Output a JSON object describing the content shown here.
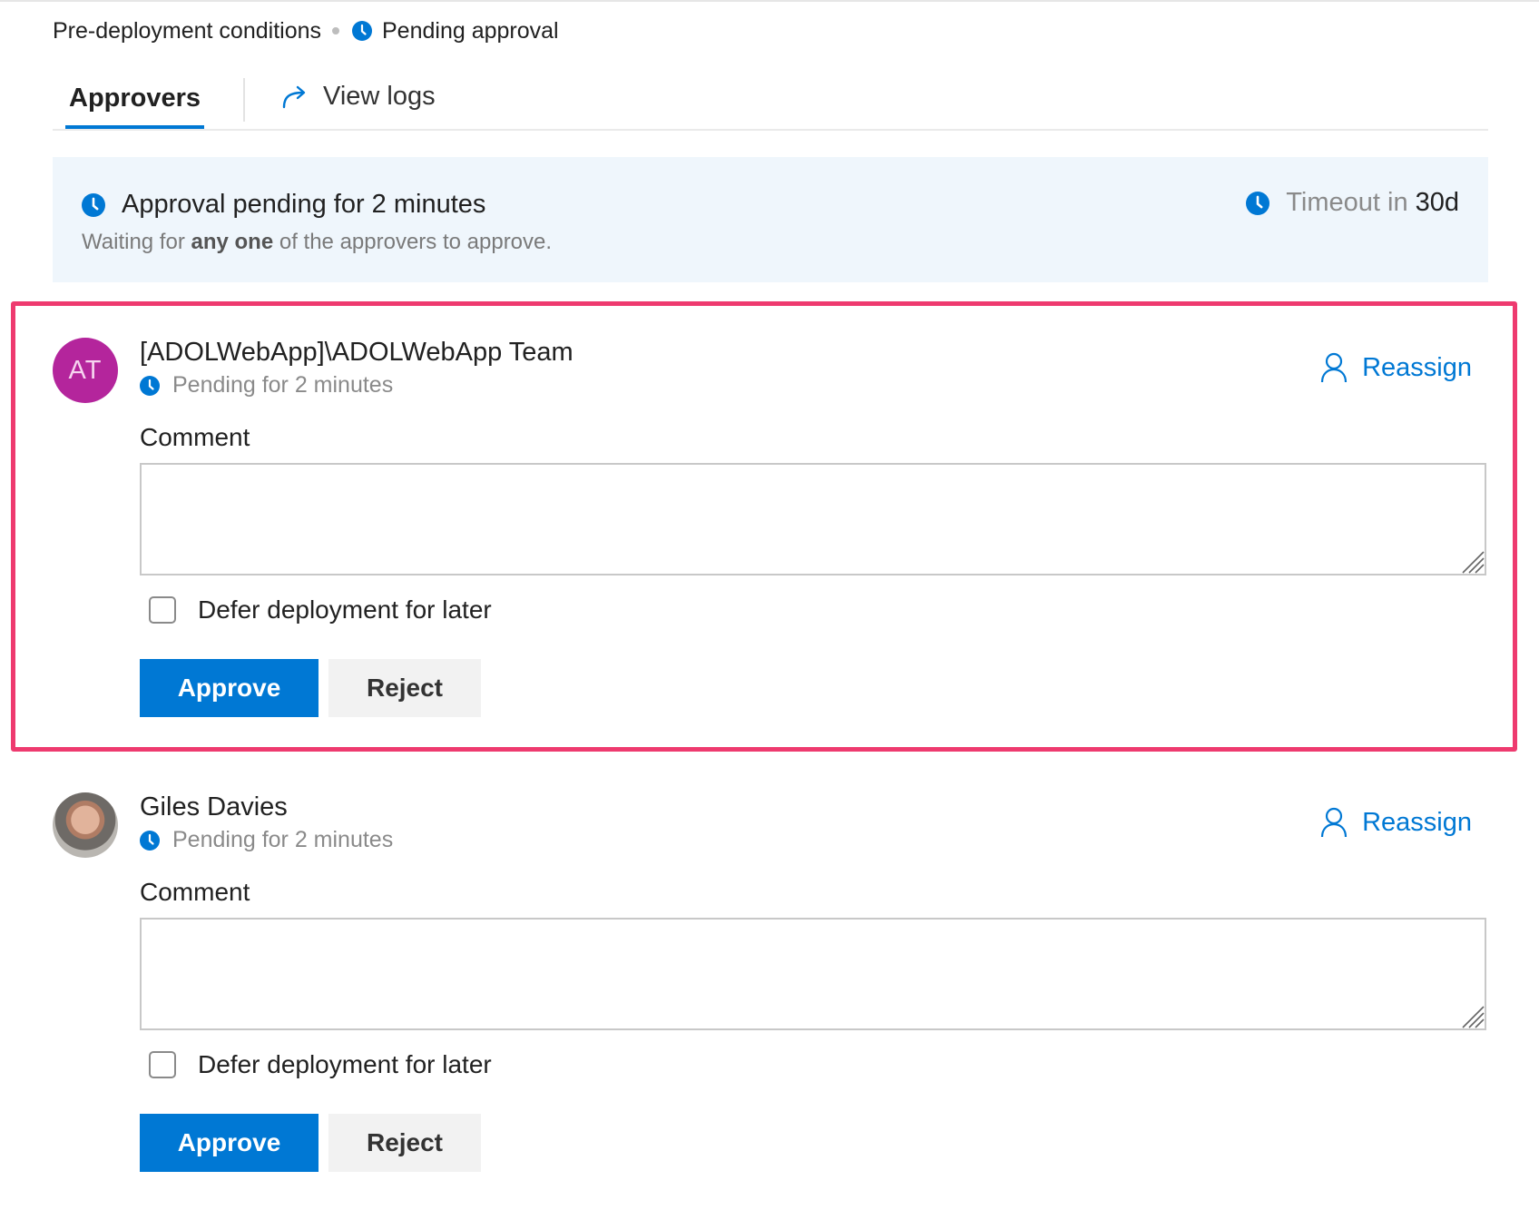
{
  "breadcrumb": {
    "section": "Pre-deployment conditions",
    "status": "Pending approval"
  },
  "tabs": [
    {
      "label": "Approvers",
      "active": true
    },
    {
      "label": "View logs",
      "icon": "share-arrow-icon",
      "active": false
    }
  ],
  "banner": {
    "title": "Approval pending for 2 minutes",
    "subtitle_prefix": "Waiting for",
    "subtitle_bold": "any one",
    "subtitle_suffix": "of the approvers to approve.",
    "timeout_label": "Timeout in",
    "timeout_value": "30d"
  },
  "approvers": [
    {
      "initials": "AT",
      "name": "[ADOLWebApp]\\ADOLWebApp Team",
      "pending": "Pending for 2 minutes",
      "reassign_label": "Reassign",
      "comment_label": "Comment",
      "comment_value": "",
      "defer_label": "Defer deployment for later",
      "defer_checked": false,
      "approve_label": "Approve",
      "reject_label": "Reject",
      "highlighted": true
    },
    {
      "initials": "",
      "name": "Giles Davies",
      "pending": "Pending for 2 minutes",
      "reassign_label": "Reassign",
      "comment_label": "Comment",
      "comment_value": "",
      "defer_label": "Defer deployment for later",
      "defer_checked": false,
      "approve_label": "Approve",
      "reject_label": "Reject",
      "highlighted": false
    }
  ],
  "colors": {
    "accent": "#0078d4",
    "banner_bg": "#eff6fc",
    "highlight_border": "#ee3a6f",
    "avatar_team": "#b4259c"
  }
}
